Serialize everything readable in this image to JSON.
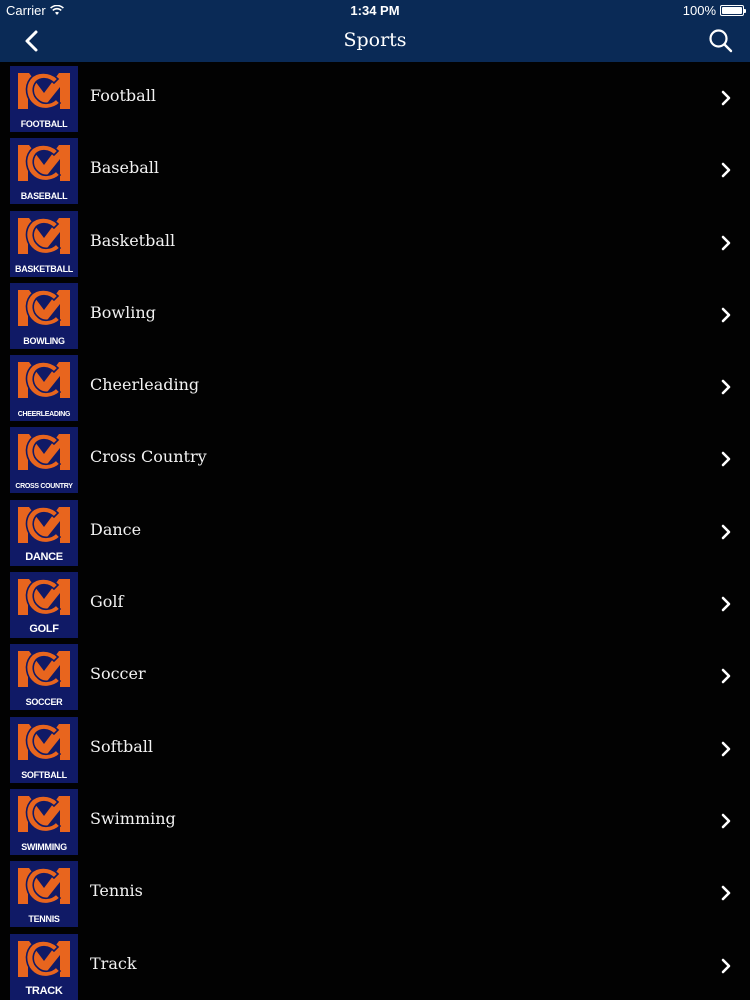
{
  "status": {
    "carrier": "Carrier",
    "time": "1:34 PM",
    "battery": "100%"
  },
  "nav": {
    "title": "Sports"
  },
  "icons": {
    "back": "chevron-left-icon",
    "search": "search-icon",
    "row": "chevron-right-icon"
  },
  "colors": {
    "nav_background": "#0a2a56",
    "logo_background": "#101a66",
    "logo_orange": "#e8651e",
    "list_background": "#000000"
  },
  "sports": [
    {
      "label": "Football",
      "logo": "FOOTBALL"
    },
    {
      "label": "Baseball",
      "logo": "BASEBALL"
    },
    {
      "label": "Basketball",
      "logo": "BASKETBALL"
    },
    {
      "label": "Bowling",
      "logo": "BOWLING"
    },
    {
      "label": "Cheerleading",
      "logo": "CHEERLEADING"
    },
    {
      "label": "Cross Country",
      "logo": "CROSS COUNTRY"
    },
    {
      "label": "Dance",
      "logo": "DANCE"
    },
    {
      "label": "Golf",
      "logo": "GOLF"
    },
    {
      "label": "Soccer",
      "logo": "SOCCER"
    },
    {
      "label": "Softball",
      "logo": "SOFTBALL"
    },
    {
      "label": "Swimming",
      "logo": "SWIMMING"
    },
    {
      "label": "Tennis",
      "logo": "TENNIS"
    },
    {
      "label": "Track",
      "logo": "TRACK"
    }
  ]
}
